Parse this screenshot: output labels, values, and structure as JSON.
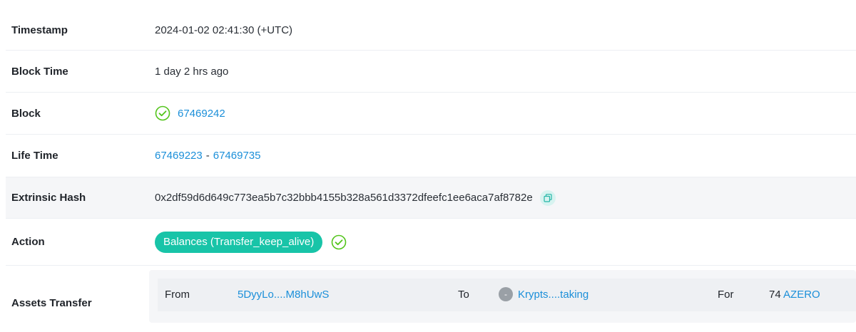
{
  "rows": [
    {
      "label": "Timestamp",
      "value": "2024-01-02 02:41:30 (+UTC)"
    },
    {
      "label": "Block Time",
      "value": "1 day 2 hrs ago"
    },
    {
      "label": "Block",
      "value": "67469242"
    },
    {
      "label": "Life Time",
      "from": "67469223",
      "separator": "-",
      "to": "67469735"
    },
    {
      "label": "Extrinsic Hash",
      "value": "0x2df59d6d649c773ea5b7c32bbb4155b328a561d3372dfeefc1ee6aca7af8782e"
    },
    {
      "label": "Action",
      "value": "Balances (Transfer_keep_alive)"
    },
    {
      "label": "Assets Transfer"
    }
  ],
  "transfer": {
    "from_label": "From",
    "from_value": "5DyyLo....M8hUwS",
    "to_label": "To",
    "to_avatar": "-",
    "to_value": "Krypts....taking",
    "for_label": "For",
    "amount": "74",
    "token": "AZERO"
  },
  "icons": {
    "block_status": "check-circle-icon",
    "action_status": "check-circle-icon",
    "hash_copy": "copy-icon",
    "to_avatar": "avatar-icon"
  },
  "colors": {
    "link": "#1b8fd9",
    "accent": "#18c4a8",
    "success": "#52c41a"
  }
}
